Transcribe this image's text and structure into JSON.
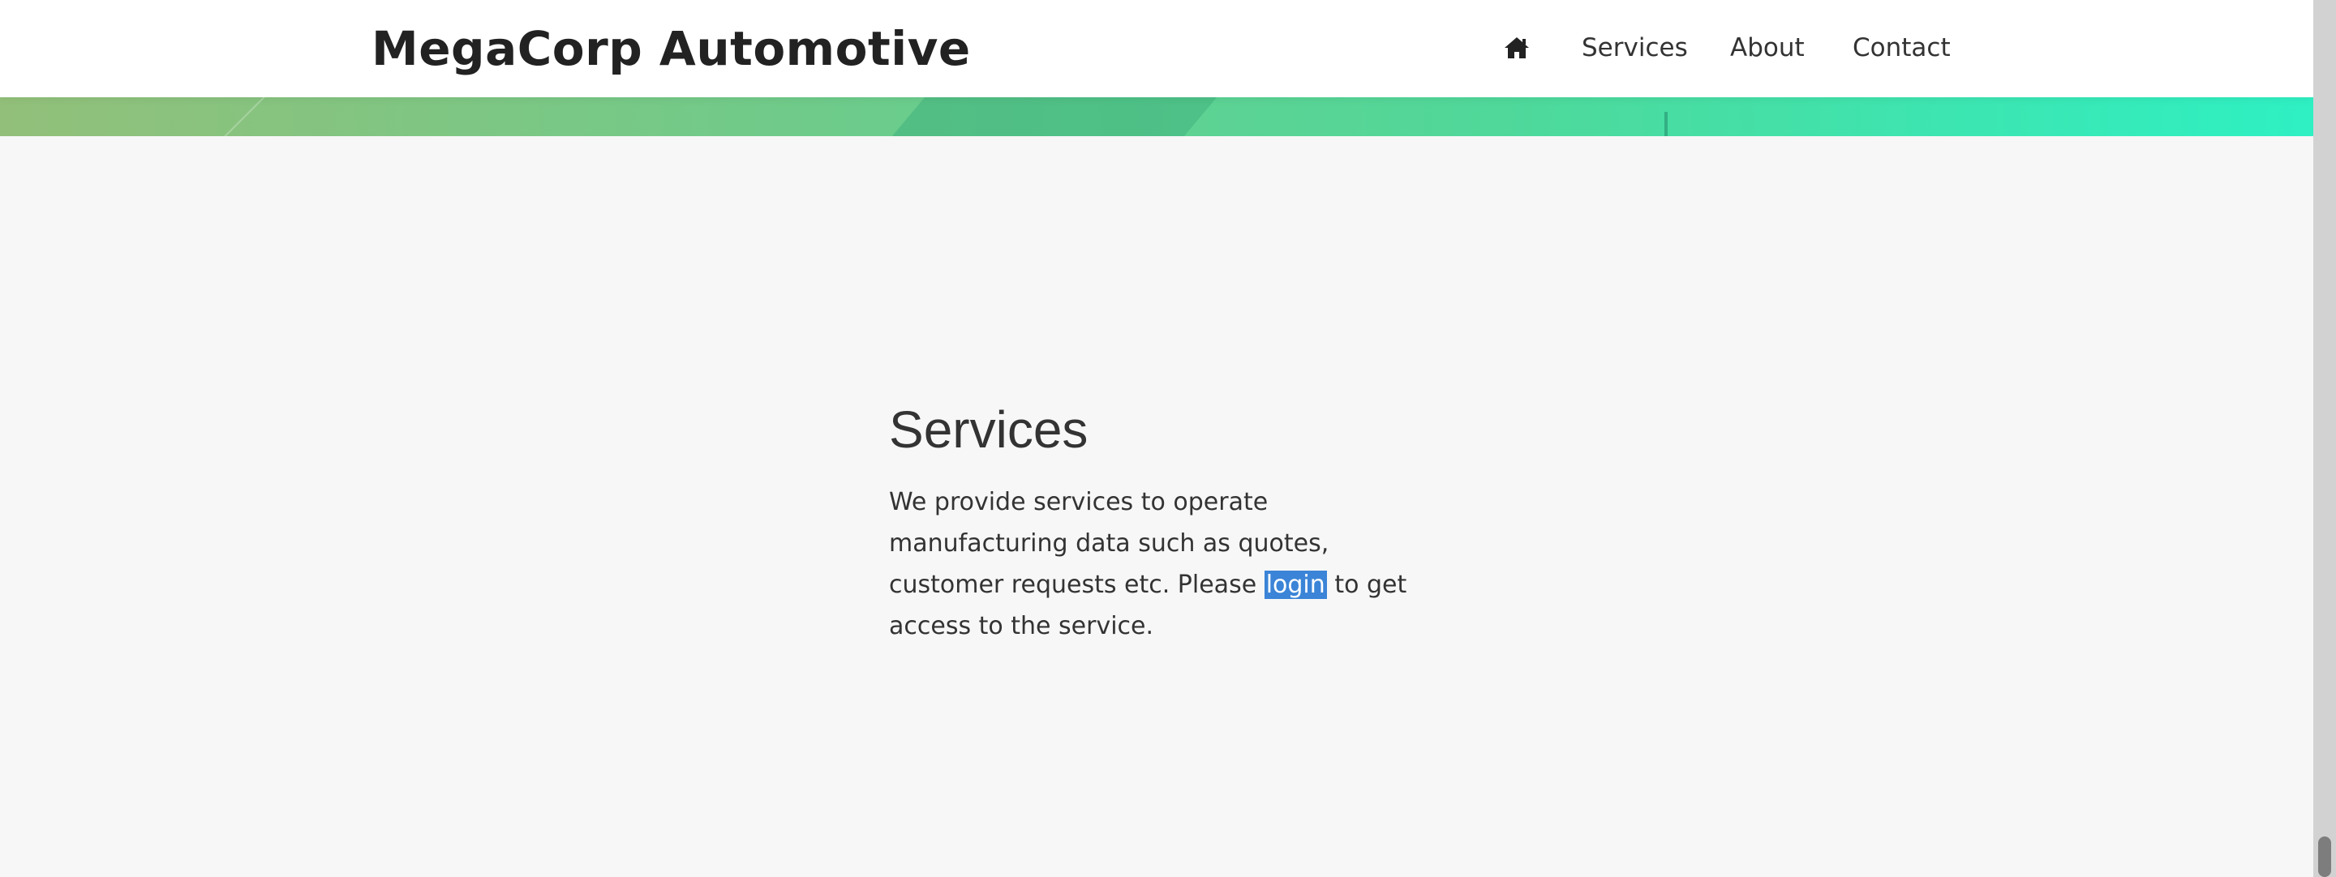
{
  "header": {
    "brand": "MegaCorp Automotive",
    "nav": {
      "home_icon": "home-icon",
      "services": "Services",
      "about": "About",
      "contact": "Contact"
    }
  },
  "hero": {
    "gradient_start": "#92c07a",
    "gradient_end": "#2ef0c3"
  },
  "main": {
    "title": "Services",
    "paragraph_before": "We provide services to operate manufacturing data such as quotes, customer requests etc. Please ",
    "login_link": "login",
    "paragraph_after": " to get access to the service."
  },
  "colors": {
    "selection_highlight": "#3b84d7",
    "page_background": "#f7f7f7"
  }
}
